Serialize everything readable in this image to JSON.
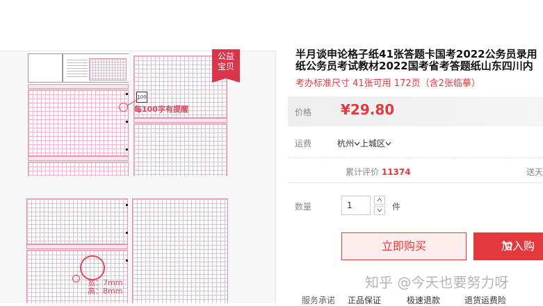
{
  "product": {
    "title_line1": "半月谈申论格子纸41张答题卡国考2022公务员录用",
    "title_line2": "纸公务员考试教材2022国考省考答题纸山东四川内",
    "subtitle": "考办标准尺寸 41张可用 172页（含2张临摹）"
  },
  "gallery": {
    "badge_line1": "公益",
    "badge_line2": "宝贝",
    "callout_100": "每100字有提醒",
    "tag_100": "100",
    "callout_width": "宽：7mm",
    "callout_height": "高：8mm"
  },
  "price": {
    "label": "价格",
    "value": "¥29.80",
    "accent_color": "#e4393c"
  },
  "shipping": {
    "label": "运费",
    "from": "杭州",
    "to": "上城区"
  },
  "stats": {
    "reviews_label": "累计评价",
    "reviews_count": "11374",
    "service_text": "送天"
  },
  "quantity": {
    "label": "数量",
    "value": "1",
    "unit": "件"
  },
  "actions": {
    "buy_now": "立即购买",
    "add_cart": "加入购"
  },
  "promise": {
    "label": "服务承诺",
    "items": [
      "正品保证",
      "极速退款",
      "退货运费险"
    ]
  },
  "watermark": "知乎 @今天也要努力呀"
}
